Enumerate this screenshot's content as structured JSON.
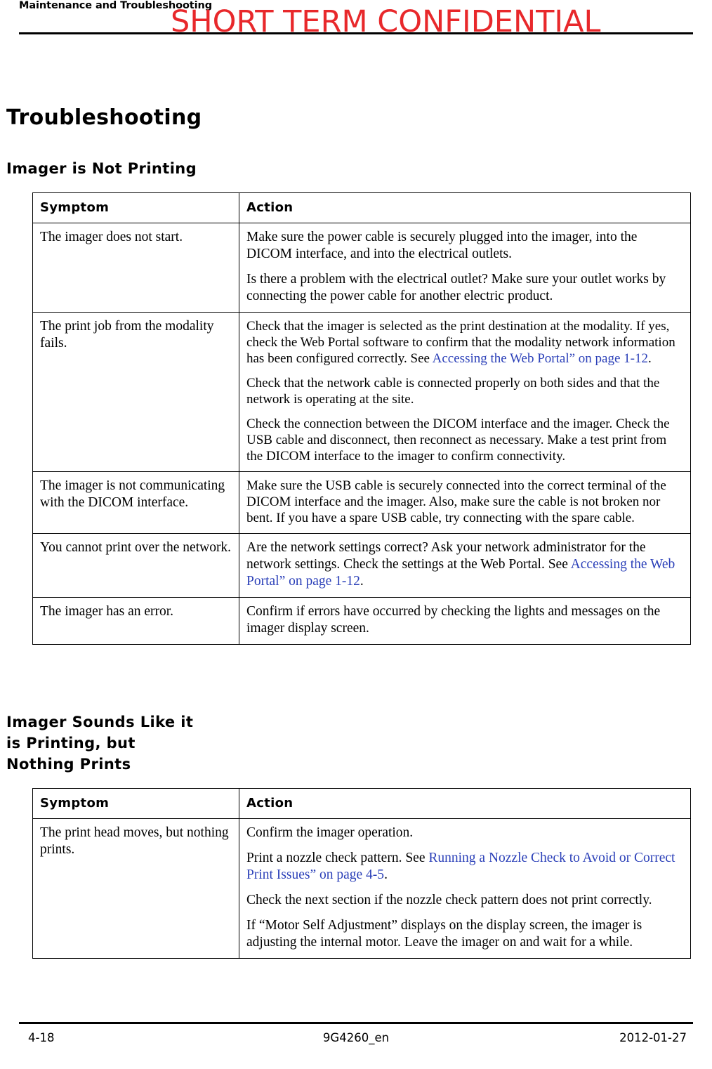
{
  "header": {
    "running_head": "Maintenance and Troubleshooting",
    "watermark": "SHORT TERM CONFIDENTIAL"
  },
  "titles": {
    "h1": "Troubleshooting",
    "section1": "Imager is Not Printing",
    "section2": "Imager Sounds Like it is Printing, but Nothing Prints"
  },
  "table1": {
    "headers": [
      "Symptom",
      "Action"
    ],
    "rows": [
      {
        "symptom": "The imager does not start.",
        "actions": [
          "Make sure the power cable is securely plugged into the imager, into the DICOM interface, and into the electrical outlets.",
          "Is there a problem with the electrical outlet? Make sure your outlet works by connecting the power cable for another electric product."
        ]
      },
      {
        "symptom": "The print job from the modality fails.",
        "actions": [
          "Check that the imager is selected as the print destination at the modality. If yes, check the Web Portal software to confirm that the modality network information has been configured correctly. See “Accessing the Web Portal” on page 1-12.",
          "Check that the network cable is connected properly on both sides and that the network is operating at the site.",
          "Check the connection between the DICOM interface and the imager. Check the USB cable and disconnect, then reconnect as necessary. Make a test print from the DICOM interface to the imager to confirm connectivity."
        ]
      },
      {
        "symptom": "The imager is not communicating with the DICOM interface.",
        "actions": [
          "Make sure the USB cable is securely connected into the correct terminal of the DICOM interface and the imager. Also, make sure the cable is not broken nor bent. If you have a spare USB cable, try connecting with the spare cable."
        ]
      },
      {
        "symptom": "You cannot print over the network.",
        "actions": [
          "Are the network settings correct? Ask your network administrator for the network settings. Check the settings at the Web Portal. See “Accessing the Web Portal” on page 1-12."
        ]
      },
      {
        "symptom": "The imager has an error.",
        "actions": [
          "Confirm if errors have occurred by checking the lights and messages on the imager display screen."
        ]
      }
    ]
  },
  "table2": {
    "headers": [
      "Symptom",
      "Action"
    ],
    "rows": [
      {
        "symptom": "The print head moves, but nothing prints.",
        "actions": [
          "Confirm the imager operation.",
          "Print a nozzle check pattern. See “Running a Nozzle Check to Avoid or Correct Print Issues” on page 4-5.",
          "Check the next section if the nozzle check pattern does not print correctly.",
          "If “Motor Self Adjustment” displays on the display screen, the imager is adjusting the internal motor. Leave the imager on and wait for a while."
        ]
      }
    ]
  },
  "links": {
    "t1r2_link": "Accessing the Web Portal” on page 1-12",
    "t1r4_link_a": "Accessing the",
    "t1r4_link_b": "Web Portal” on page 1-12",
    "t2r1_link_a": "Running a Nozzle Check to Avoid or Correct",
    "t2r1_link_b": "Print Issues” on page 4-5"
  },
  "footer": {
    "page_number": "4-18",
    "doc_number": "9G4260_en",
    "date": "2012-01-27"
  }
}
